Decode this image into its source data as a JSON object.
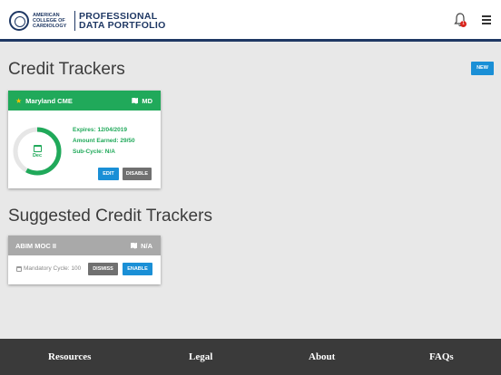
{
  "header": {
    "org_lines": [
      "American",
      "College of",
      "Cardiology"
    ],
    "product_lines": [
      "PROFESSIONAL",
      "DATA PORTFOLIO"
    ],
    "notification_count": "1"
  },
  "credit_trackers": {
    "title": "Credit Trackers",
    "new_label": "NEW",
    "card": {
      "name": "Maryland CME",
      "state": "MD",
      "gauge_label": "Dec",
      "gauge_fraction": 0.58,
      "expires": "Expires: 12/04/2019",
      "amount": "Amount Earned: 29/50",
      "subcycle": "Sub-Cycle: N/A",
      "edit_label": "EDIT",
      "disable_label": "DISABLE"
    }
  },
  "suggested": {
    "title": "Suggested Credit Trackers",
    "card": {
      "name": "ABIM MOC II",
      "state": "N/A",
      "mandatory": "Mandatory Cycle: 100",
      "dismiss_label": "DISMISS",
      "enable_label": "ENABLE"
    }
  },
  "footer": {
    "links": [
      "Resources",
      "Legal",
      "About",
      "FAQs"
    ]
  },
  "colors": {
    "navy": "#1f3864",
    "green": "#20a95a",
    "blue": "#1a8fd6",
    "gray_header": "#a9a9a9",
    "footer": "#3a3a3a"
  }
}
